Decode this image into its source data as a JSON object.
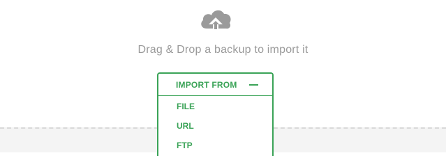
{
  "dropzone": {
    "icon": "cloud-upload-icon",
    "message": "Drag & Drop a backup to import it"
  },
  "import_dropdown": {
    "label": "IMPORT FROM",
    "toggle_icon": "minus-icon",
    "items": [
      {
        "label": "FILE"
      },
      {
        "label": "URL"
      },
      {
        "label": "FTP"
      }
    ]
  },
  "colors": {
    "accent": "#3aa357",
    "icon_gray": "#9a9a9a",
    "text_gray": "#9a9a9a"
  }
}
